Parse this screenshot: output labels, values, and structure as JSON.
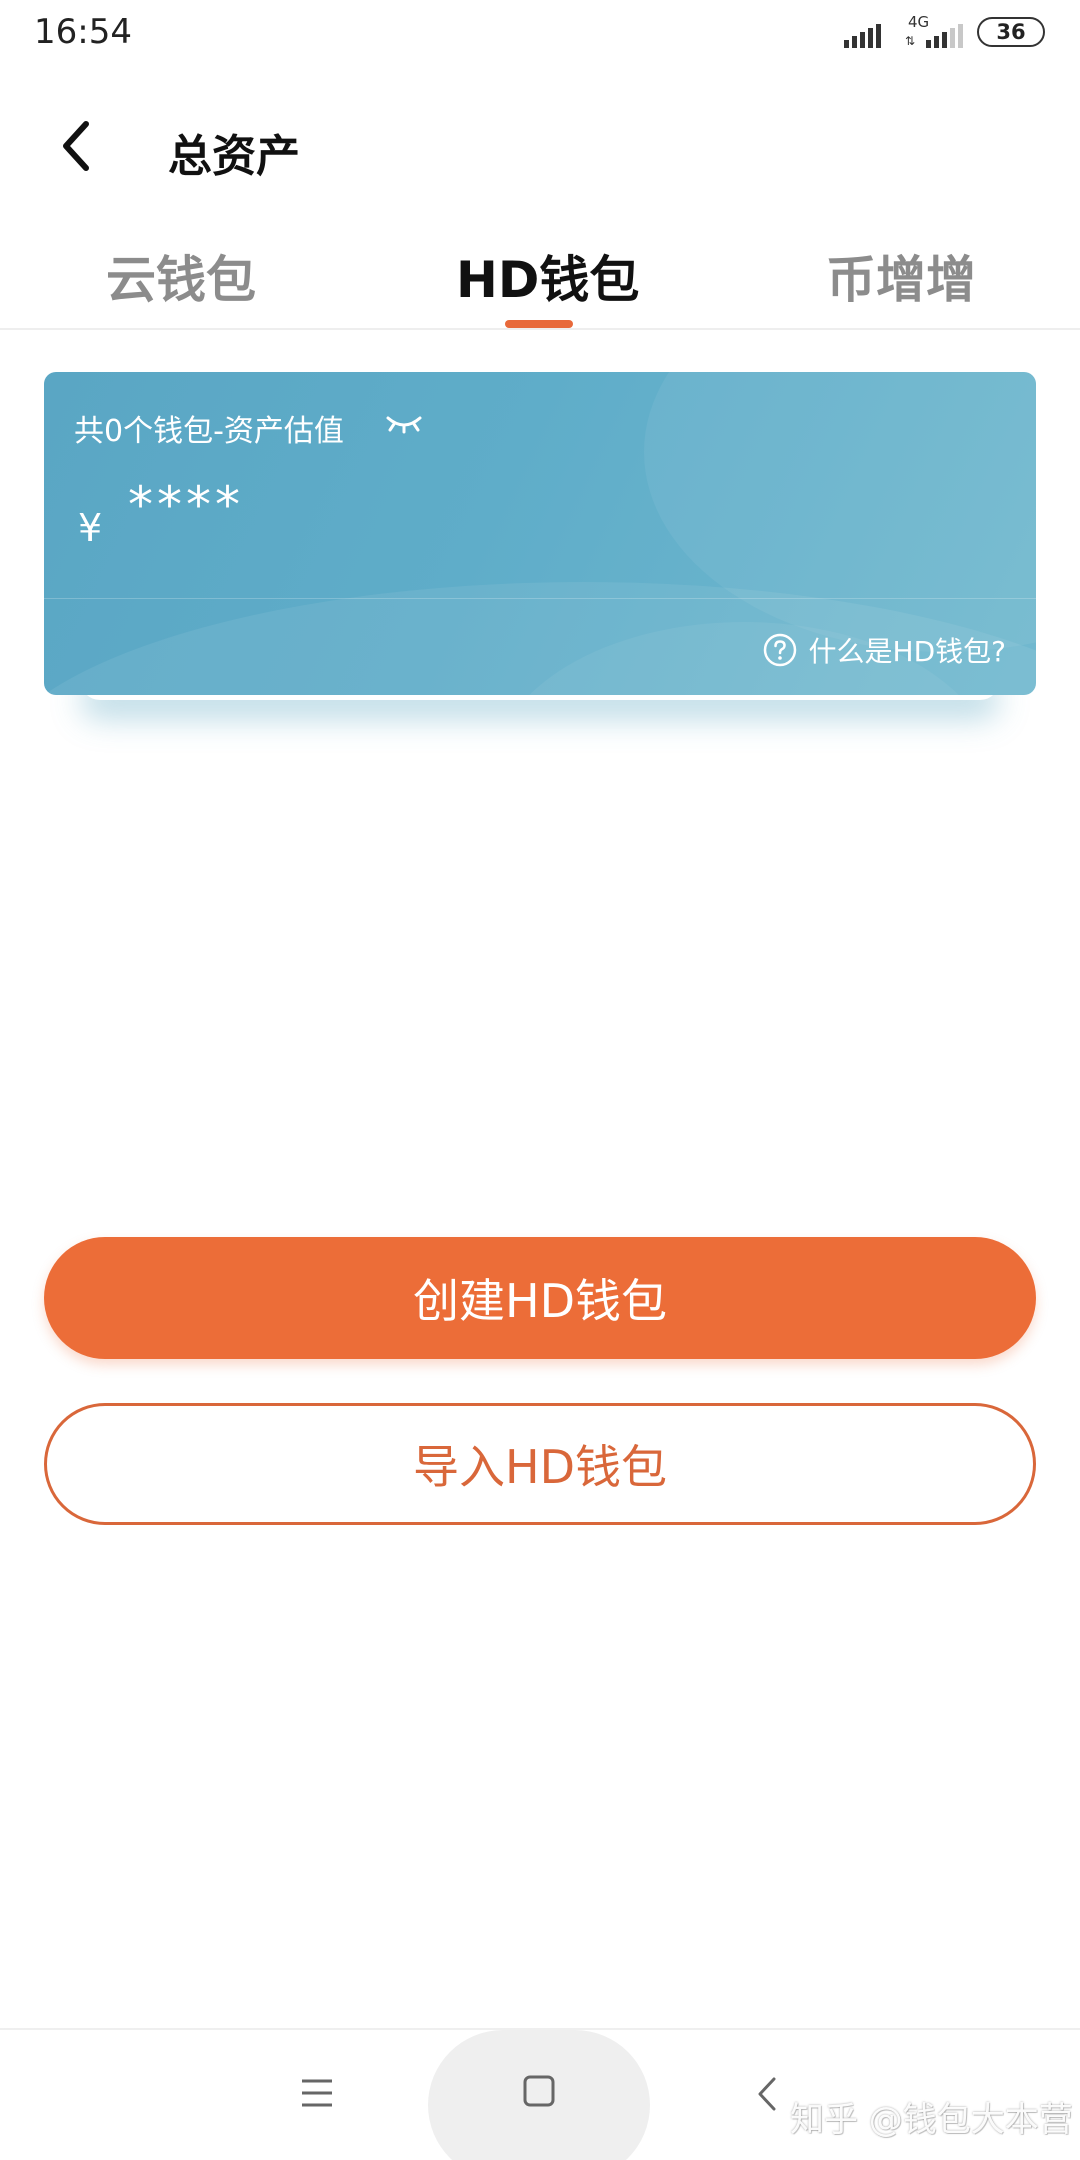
{
  "status_bar": {
    "time": "16:54",
    "network": "4G",
    "network_arrows": "⇅",
    "battery": "36"
  },
  "header": {
    "title": "总资产",
    "back_icon": "chevron-left-icon"
  },
  "tabs": {
    "items": [
      {
        "label": "云钱包",
        "active": false
      },
      {
        "label": "HD钱包",
        "active": true
      },
      {
        "label": "币增增",
        "active": false
      }
    ]
  },
  "asset_card": {
    "label": "共0个钱包-资产估值",
    "currency_symbol": "¥",
    "amount_masked": "****",
    "help_text": "什么是HD钱包?",
    "visibility_icon": "eye-closed-icon",
    "help_icon": "question-circle-icon"
  },
  "actions": {
    "create_label": "创建HD钱包",
    "import_label": "导入HD钱包"
  },
  "nav": {
    "menu_icon": "menu-icon",
    "home_icon": "home-square-icon",
    "back_icon": "back-chevron-icon"
  },
  "watermark": "知乎 @钱包大本营",
  "colors": {
    "accent": "#ec6d38",
    "card": "#5fadc9",
    "tab_inactive": "#8c8c8c",
    "tab_active": "#111111"
  }
}
